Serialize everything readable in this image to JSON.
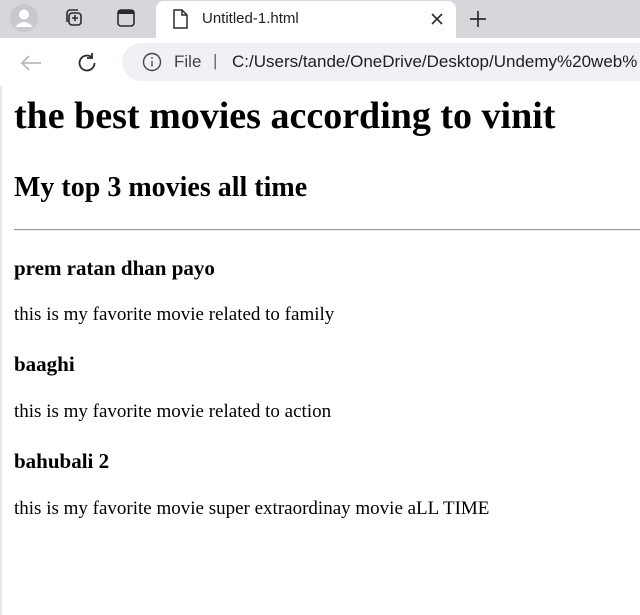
{
  "browser": {
    "tab": {
      "title": "Untitled-1.html",
      "close_icon": "close-icon",
      "page_icon": "document-icon"
    },
    "icons": {
      "profile": "profile-icon",
      "workspaces": "workspaces-icon",
      "vertical_tabs": "vertical-tabs-icon",
      "new_tab": "plus-icon",
      "back": "back-arrow-icon",
      "reload": "reload-icon",
      "site_info": "info-icon"
    },
    "address_bar": {
      "scheme_label": "File",
      "separator": "|",
      "url": "C:/Users/tande/OneDrive/Desktop/Undemy%20web%"
    }
  },
  "page": {
    "title": "the best movies according to vinit",
    "subtitle": "My top 3 movies all time",
    "movies": [
      {
        "name": "prem ratan dhan payo",
        "description": "this is my favorite movie related to family"
      },
      {
        "name": "baaghi",
        "description": "this is my favorite movie related to action"
      },
      {
        "name": "bahubali 2",
        "description": "this is my favorite movie super extraordinay movie aLL TIME"
      }
    ]
  },
  "colors": {
    "tabstrip_bg": "#d6d7db",
    "omnibox_bg": "#eff1f4",
    "text": "#000000"
  }
}
